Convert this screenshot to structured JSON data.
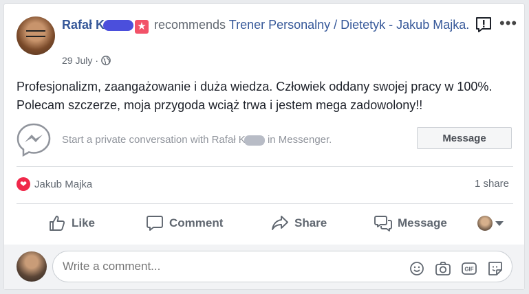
{
  "post": {
    "author": "Rafał K",
    "verb": "recommends",
    "page": "Trener Personalny / Dietetyk - Jakub Majka.",
    "date": "29 July",
    "separator": "·",
    "text": "Profesjonalizm, zaangażowanie i duża wiedza. Człowiek oddany swojej pracy w 100%. Polecam szczerze, moja przygoda wciąż trwa i jestem mega zadowolony!!"
  },
  "messenger": {
    "prompt_start": "Start a private conversation with Rafał K",
    "prompt_end": "in Messenger.",
    "button": "Message"
  },
  "reactions": {
    "name": "Jakub Majka",
    "shares": "1 share"
  },
  "actions": {
    "like": "Like",
    "comment": "Comment",
    "share": "Share",
    "message": "Message"
  },
  "comment_box": {
    "placeholder": "Write a comment..."
  },
  "colors": {
    "link": "#365899",
    "badge": "#f25268",
    "love": "#f0284a"
  }
}
